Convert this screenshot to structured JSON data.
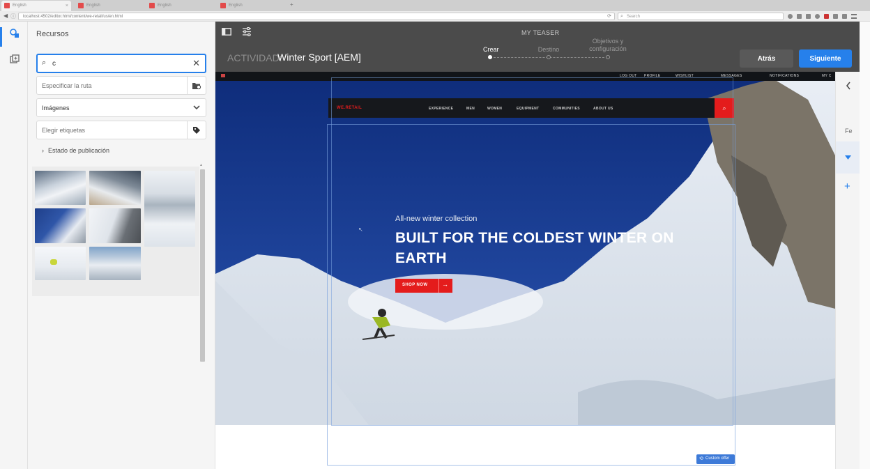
{
  "browser": {
    "tabs": [
      {
        "title": "English"
      },
      {
        "title": "English"
      },
      {
        "title": "English"
      },
      {
        "title": "English"
      }
    ],
    "url": "localhost:4502/editor.html/content/we-retail/us/en.html",
    "search_placeholder": "Search"
  },
  "panel": {
    "title": "Recursos",
    "search_value": "c",
    "path_placeholder": "Especificar la ruta",
    "asset_type": "Imágenes",
    "tags_placeholder": "Elegir etiquetas",
    "publication_status": "Estado de publicación"
  },
  "header": {
    "teaser_name": "MY TEASER",
    "activity_label": "ACTIVIDAD:",
    "activity_name": "Winter Sport [AEM]",
    "steps": [
      {
        "label": "Crear"
      },
      {
        "label": "Destino"
      },
      {
        "label": "Objetivos y configuración"
      }
    ],
    "current_step": 0,
    "back_label": "Atrás",
    "next_label": "Siguiente"
  },
  "site": {
    "top_links": [
      "LOG OUT",
      "PROFILE",
      "WISHLIST",
      "MESSAGES",
      "NOTIFICATIONS",
      "MY C"
    ],
    "logo": "WE.RETAIL",
    "nav": [
      "EXPERIENCE",
      "MEN",
      "WOMEN",
      "EQUIPMENT",
      "COMMUNITIES",
      "ABOUT US"
    ],
    "kicker": "All-new winter collection",
    "headline_1": "BUILT FOR THE COLDEST WINTER ON",
    "headline_2": "EARTH",
    "cta": "SHOP NOW",
    "custom_offer": "Custom offer"
  },
  "right_rail": {
    "label": "Fe"
  },
  "colors": {
    "accent": "#2680eb",
    "header_bg": "#4b4b4b",
    "brand_red": "#e41c1c"
  }
}
